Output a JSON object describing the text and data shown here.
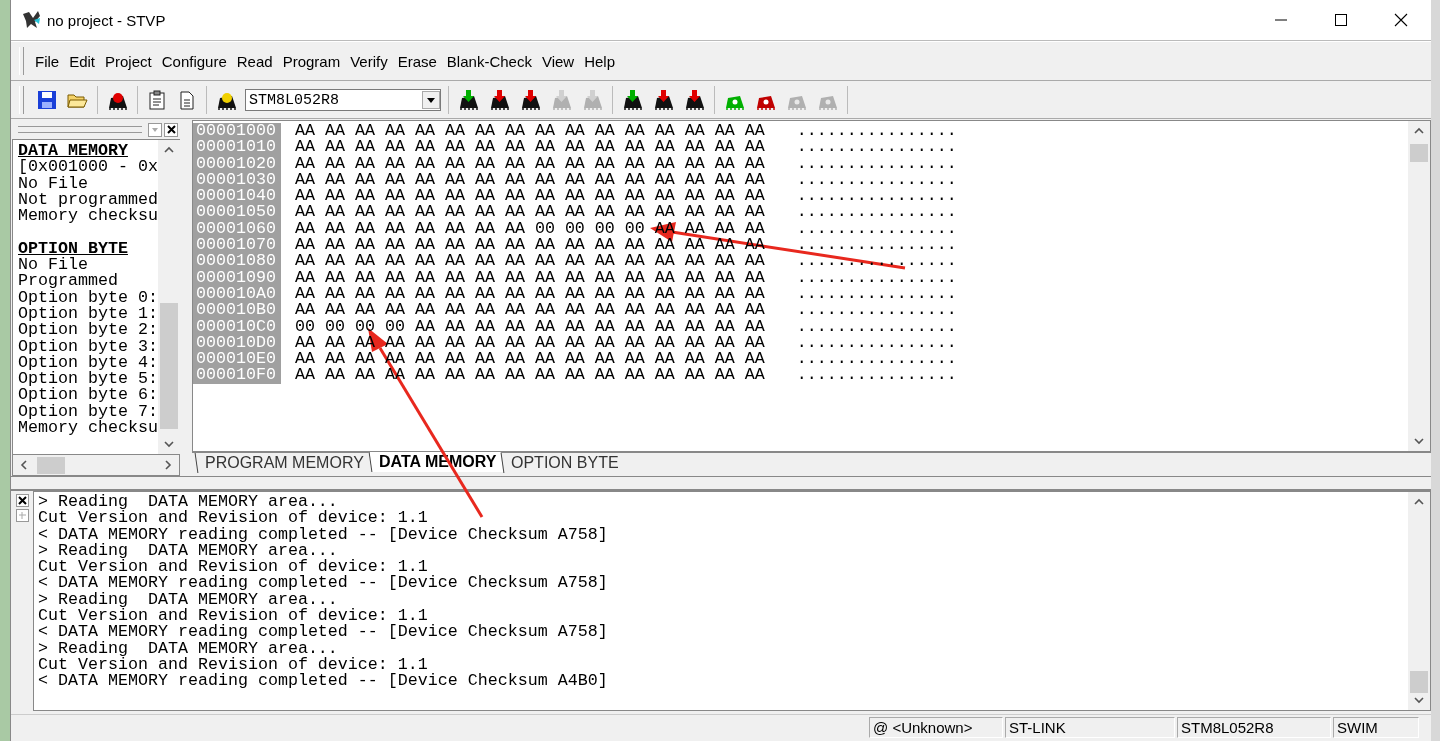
{
  "window": {
    "title": "no project - STVP"
  },
  "menu": [
    {
      "label": "File"
    },
    {
      "label": "Edit"
    },
    {
      "label": "Project"
    },
    {
      "label": "Configure"
    },
    {
      "label": "Read"
    },
    {
      "label": "Program"
    },
    {
      "label": "Verify"
    },
    {
      "label": "Erase"
    },
    {
      "label": "Blank-Check"
    },
    {
      "label": "View"
    },
    {
      "label": "Help"
    }
  ],
  "toolbar": {
    "groups": [
      [
        {
          "kind": "save"
        },
        {
          "kind": "open"
        }
      ],
      [
        {
          "kind": "chip",
          "color": "#e00000"
        }
      ],
      [
        {
          "kind": "clipboard"
        },
        {
          "kind": "document"
        }
      ],
      [
        {
          "kind": "chip",
          "color": "#f0d000"
        },
        {
          "kind": "device_select",
          "value": "STM8L052R8"
        }
      ],
      [
        {
          "kind": "arrow_chip",
          "color": "#00b000",
          "disabled": false
        },
        {
          "kind": "arrow_chip",
          "color": "#e00000",
          "disabled": false
        },
        {
          "kind": "arrow_chip",
          "color": "#e00000",
          "disabled": false
        },
        {
          "kind": "arrow_chip",
          "disabled": true
        },
        {
          "kind": "arrow_chip",
          "disabled": true
        }
      ],
      [
        {
          "kind": "arrow_chip",
          "color": "#00b000",
          "disabled": false
        },
        {
          "kind": "arrow_chip",
          "color": "#e00000",
          "disabled": false
        },
        {
          "kind": "arrow_chip",
          "color": "#e00000",
          "disabled": false
        }
      ],
      [
        {
          "kind": "colored_chip",
          "color": "#00b000",
          "disabled": false
        },
        {
          "kind": "colored_chip",
          "color": "#c00000",
          "disabled": false
        },
        {
          "kind": "colored_chip",
          "disabled": true
        },
        {
          "kind": "colored_chip",
          "disabled": true
        }
      ]
    ]
  },
  "info_panel": {
    "sections": [
      {
        "heading": "DATA MEMORY",
        "lines": [
          "[0x001000 - 0x",
          "No File",
          "Not programmed",
          "Memory checksu"
        ]
      },
      {
        "heading": "OPTION BYTE",
        "lines": [
          "No File",
          "Programmed",
          "Option byte 0:",
          "Option byte 1:",
          "Option byte 2:",
          "Option byte 3:",
          "Option byte 4:",
          "Option byte 5:",
          "Option byte 6:",
          "Option byte 7:",
          "Memory checksu"
        ]
      }
    ]
  },
  "memory_view": {
    "rows": [
      {
        "address": "00001000",
        "bytes": "AA AA AA AA AA AA AA AA AA AA AA AA AA AA AA AA",
        "ascii": "................"
      },
      {
        "address": "00001010",
        "bytes": "AA AA AA AA AA AA AA AA AA AA AA AA AA AA AA AA",
        "ascii": "................"
      },
      {
        "address": "00001020",
        "bytes": "AA AA AA AA AA AA AA AA AA AA AA AA AA AA AA AA",
        "ascii": "................"
      },
      {
        "address": "00001030",
        "bytes": "AA AA AA AA AA AA AA AA AA AA AA AA AA AA AA AA",
        "ascii": "................"
      },
      {
        "address": "00001040",
        "bytes": "AA AA AA AA AA AA AA AA AA AA AA AA AA AA AA AA",
        "ascii": "................"
      },
      {
        "address": "00001050",
        "bytes": "AA AA AA AA AA AA AA AA AA AA AA AA AA AA AA AA",
        "ascii": "................"
      },
      {
        "address": "00001060",
        "bytes": "AA AA AA AA AA AA AA AA 00 00 00 00 AA AA AA AA",
        "ascii": "................"
      },
      {
        "address": "00001070",
        "bytes": "AA AA AA AA AA AA AA AA AA AA AA AA AA AA AA AA",
        "ascii": "................"
      },
      {
        "address": "00001080",
        "bytes": "AA AA AA AA AA AA AA AA AA AA AA AA AA AA AA AA",
        "ascii": "................"
      },
      {
        "address": "00001090",
        "bytes": "AA AA AA AA AA AA AA AA AA AA AA AA AA AA AA AA",
        "ascii": "................"
      },
      {
        "address": "000010A0",
        "bytes": "AA AA AA AA AA AA AA AA AA AA AA AA AA AA AA AA",
        "ascii": "................"
      },
      {
        "address": "000010B0",
        "bytes": "AA AA AA AA AA AA AA AA AA AA AA AA AA AA AA AA",
        "ascii": "................"
      },
      {
        "address": "000010C0",
        "bytes": "00 00 00 00 AA AA AA AA AA AA AA AA AA AA AA AA",
        "ascii": "................"
      },
      {
        "address": "000010D0",
        "bytes": "AA AA AA AA AA AA AA AA AA AA AA AA AA AA AA AA",
        "ascii": "................"
      },
      {
        "address": "000010E0",
        "bytes": "AA AA AA AA AA AA AA AA AA AA AA AA AA AA AA AA",
        "ascii": "................"
      },
      {
        "address": "000010F0",
        "bytes": "AA AA AA AA AA AA AA AA AA AA AA AA AA AA AA AA",
        "ascii": "................"
      }
    ],
    "tabs": [
      {
        "label": "PROGRAM MEMORY",
        "selected": false
      },
      {
        "label": "DATA MEMORY",
        "selected": true
      },
      {
        "label": "OPTION BYTE",
        "selected": false
      }
    ]
  },
  "log": {
    "lines": [
      "> Reading  DATA MEMORY area...",
      "Cut Version and Revision of device: 1.1",
      "< DATA MEMORY reading completed -- [Device Checksum A758]",
      "> Reading  DATA MEMORY area...",
      "Cut Version and Revision of device: 1.1",
      "< DATA MEMORY reading completed -- [Device Checksum A758]",
      "> Reading  DATA MEMORY area...",
      "Cut Version and Revision of device: 1.1",
      "< DATA MEMORY reading completed -- [Device Checksum A758]",
      "> Reading  DATA MEMORY area...",
      "Cut Version and Revision of device: 1.1",
      "< DATA MEMORY reading completed -- [Device Checksum A4B0]"
    ]
  },
  "status_bar": {
    "fields": [
      "@ <Unknown>",
      "ST-LINK",
      "STM8L052R8",
      "SWIM"
    ]
  }
}
